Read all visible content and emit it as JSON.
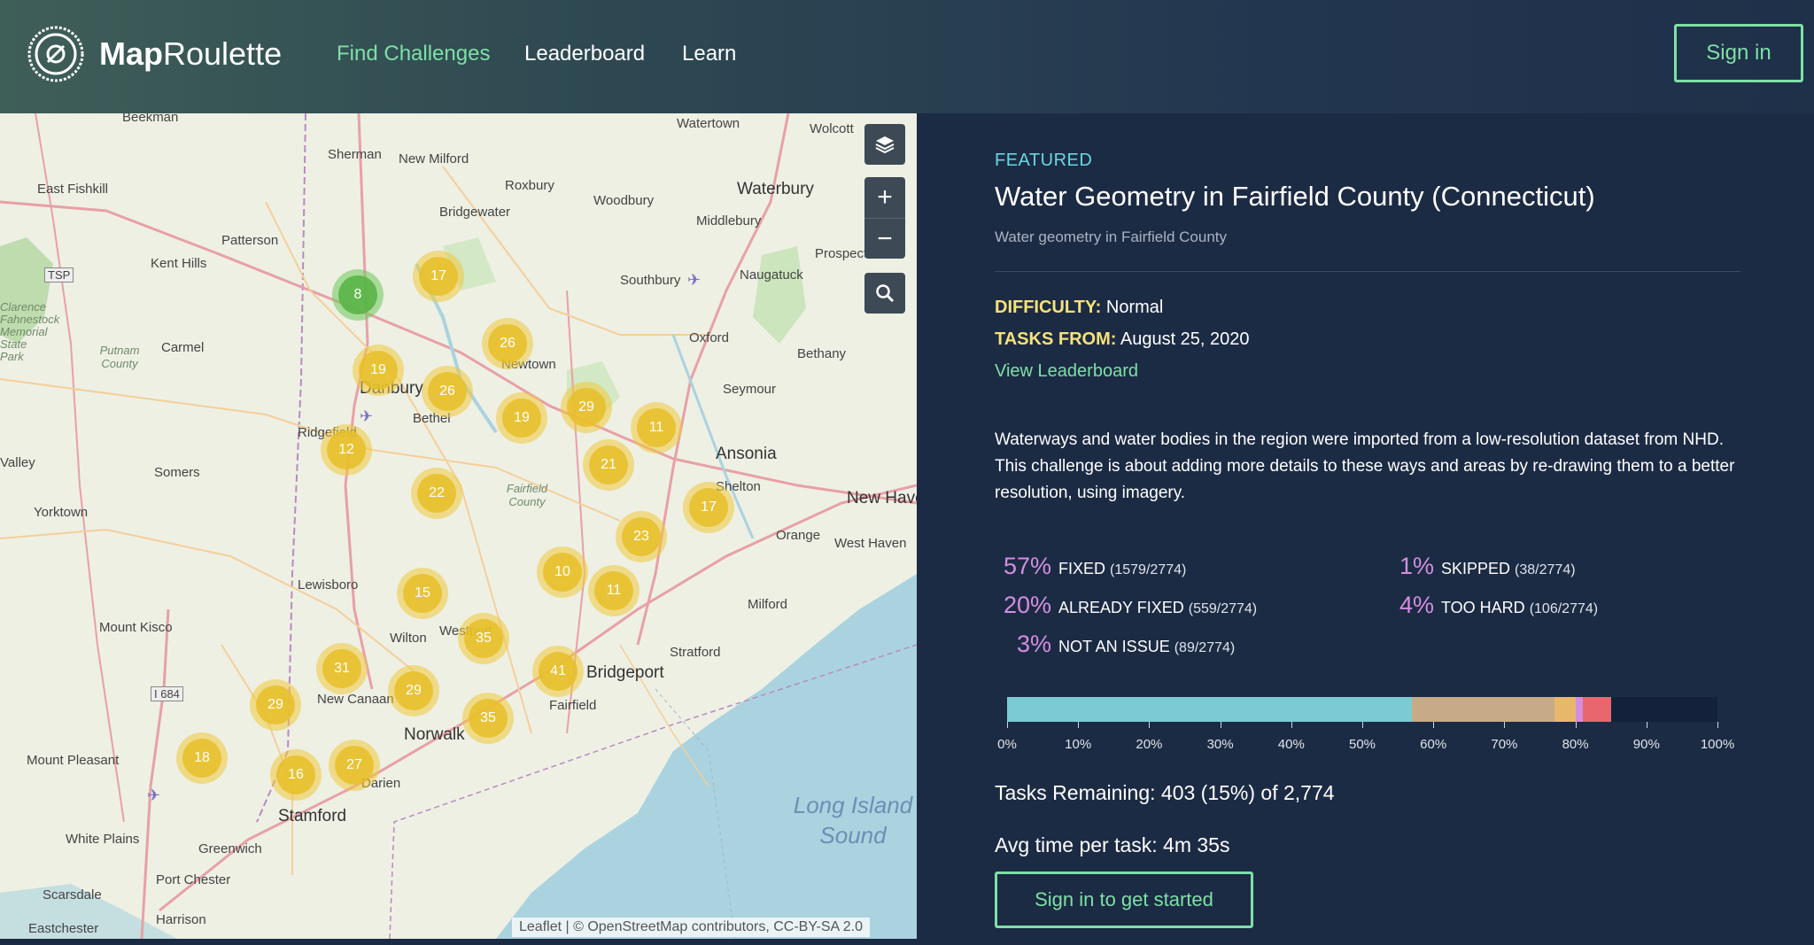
{
  "header": {
    "brand_bold": "Map",
    "brand_rest": "Roulette",
    "nav": [
      "Find Challenges",
      "Leaderboard",
      "Learn"
    ],
    "signin_label": "Sign in"
  },
  "map": {
    "labels": [
      "Beekman",
      "Sherman",
      "New Milford",
      "Watertown",
      "Wolcott",
      "East Fishkill",
      "Roxbury",
      "Waterbury",
      "Woodbury",
      "Bridgewater",
      "Middlebury",
      "Patterson",
      "Kent Hills",
      "Prospect",
      "Southbury",
      "Naugatuck",
      "TSP",
      "Carmel",
      "Oxford",
      "Danbury",
      "Newtown",
      "Bethany",
      "Bethel",
      "Seymour",
      "Ridgefield",
      "Ansonia",
      "Valley",
      "Somers",
      "Shelton",
      "Yorktown",
      "New Haven",
      "Orange",
      "West Haven",
      "Lewisboro",
      "Milford",
      "Mount Kisco",
      "Wilton",
      "Westport",
      "Stratford",
      "Bridgeport",
      "I 684",
      "New Canaan",
      "Fairfield",
      "Norwalk",
      "Mount Pleasant",
      "Darien",
      "Stamford",
      "White Plains",
      "Greenwich",
      "Port Chester",
      "Scarsdale",
      "Harrison",
      "Eastchester",
      "Putnam County",
      "Fairfield County",
      "Clarence Fahnestock Memorial State Park",
      "Long Island Sound"
    ],
    "clusters": [
      {
        "n": "8",
        "color": "green"
      },
      {
        "n": "17"
      },
      {
        "n": "26"
      },
      {
        "n": "19"
      },
      {
        "n": "26"
      },
      {
        "n": "19"
      },
      {
        "n": "29"
      },
      {
        "n": "11"
      },
      {
        "n": "12"
      },
      {
        "n": "21"
      },
      {
        "n": "22"
      },
      {
        "n": "17"
      },
      {
        "n": "23"
      },
      {
        "n": "10"
      },
      {
        "n": "15"
      },
      {
        "n": "11"
      },
      {
        "n": "35"
      },
      {
        "n": "31"
      },
      {
        "n": "41"
      },
      {
        "n": "29"
      },
      {
        "n": "29"
      },
      {
        "n": "35"
      },
      {
        "n": "18"
      },
      {
        "n": "16"
      },
      {
        "n": "27"
      }
    ],
    "controls": {
      "layers_icon": "layers-icon",
      "zoom_in": "+",
      "zoom_out": "−",
      "search_icon": "search-icon"
    },
    "attribution": "Leaflet | © OpenStreetMap contributors, CC-BY-SA 2.0"
  },
  "panel": {
    "featured": "FEATURED",
    "title": "Water Geometry in Fairfield County (Connecticut)",
    "subtitle": "Water geometry in Fairfield County",
    "difficulty_label": "DIFFICULTY:",
    "difficulty_value": "Normal",
    "tasks_from_label": "TASKS FROM:",
    "tasks_from_value": "August 25, 2020",
    "view_leaderboard": "View Leaderboard",
    "description": "Waterways and water bodies in the region were imported from a low-resolution dataset from NHD. This challenge is about adding more details to these ways and areas by re-drawing them to a better resolution, using imagery.",
    "stats": [
      {
        "pct": "57%",
        "label": "FIXED",
        "count": "(1579/2774)"
      },
      {
        "pct": "1%",
        "label": "SKIPPED",
        "count": "(38/2774)"
      },
      {
        "pct": "20%",
        "label": "ALREADY FIXED",
        "count": "(559/2774)"
      },
      {
        "pct": "4%",
        "label": "TOO HARD",
        "count": "(106/2774)"
      },
      {
        "pct": "3%",
        "label": "NOT AN ISSUE",
        "count": "(89/2774)"
      }
    ],
    "progress": {
      "segments": [
        {
          "name": "fixed",
          "fraction": 0.57,
          "color": "#7ccbd4"
        },
        {
          "name": "already-fixed",
          "fraction": 0.2,
          "color": "#c6ab86"
        },
        {
          "name": "not-an-issue",
          "fraction": 0.03,
          "color": "#e8b86a"
        },
        {
          "name": "skipped",
          "fraction": 0.01,
          "color": "#d38ee0"
        },
        {
          "name": "too-hard",
          "fraction": 0.04,
          "color": "#e8676e"
        }
      ],
      "remaining_color": "#13213a",
      "tick_labels": [
        "0%",
        "10%",
        "20%",
        "30%",
        "40%",
        "50%",
        "60%",
        "70%",
        "80%",
        "90%",
        "100%"
      ]
    },
    "tasks_remaining": "Tasks Remaining: 403 (15%) of 2,774",
    "avg_time": "Avg time per task:  4m 35s",
    "cta_label": "Sign in to get started"
  }
}
